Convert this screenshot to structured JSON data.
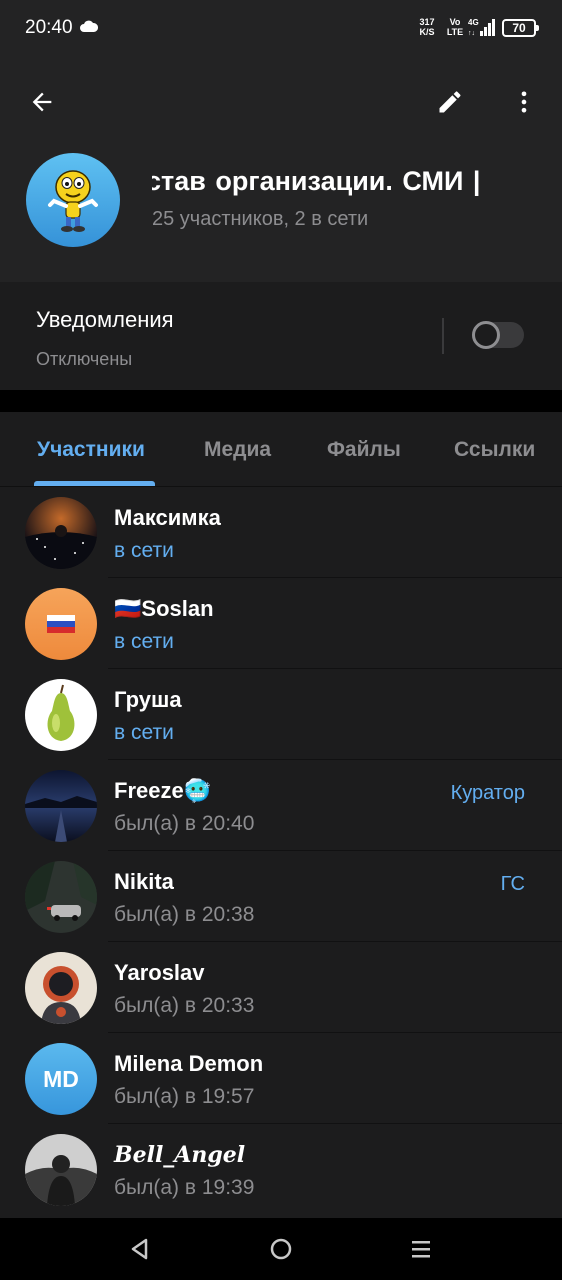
{
  "status_bar": {
    "time": "20:40",
    "net_speed_value": "317",
    "net_speed_unit": "K/S",
    "volte_top": "Vo",
    "volte_bottom": "LTE",
    "battery": "70"
  },
  "header": {
    "title": "став организации.   СМИ |",
    "subtitle": "25 участников, 2 в сети"
  },
  "notifications": {
    "label": "Уведомления",
    "value": "Отключены",
    "enabled": false
  },
  "tabs": [
    {
      "label": "Участники",
      "active": true
    },
    {
      "label": "Медиа",
      "active": false
    },
    {
      "label": "Файлы",
      "active": false
    },
    {
      "label": "Ссылки",
      "active": false
    }
  ],
  "members": [
    {
      "name": "Максимка",
      "status": "в сети",
      "online": true,
      "role": ""
    },
    {
      "name": "🇷🇺Soslan",
      "status": "в сети",
      "online": true,
      "role": ""
    },
    {
      "name": "Груша",
      "status": "в сети",
      "online": true,
      "role": ""
    },
    {
      "name": "Freeze🥶",
      "status": "был(а) в 20:40",
      "online": false,
      "role": "Куратор"
    },
    {
      "name": "Nikita",
      "status": "был(а) в 20:38",
      "online": false,
      "role": "ГС"
    },
    {
      "name": "Yaroslav",
      "status": "был(а) в 20:33",
      "online": false,
      "role": ""
    },
    {
      "name": "Milena Demon",
      "status": "был(а) в 19:57",
      "online": false,
      "role": "",
      "initials": "MD"
    },
    {
      "name": "Bell_Angel",
      "status": "был(а) в 19:39",
      "online": false,
      "role": ""
    }
  ],
  "colors": {
    "accent": "#63aef0",
    "background": "#1c1c1d",
    "header": "#232324",
    "secondary_text": "#8d8d90"
  },
  "icons": {
    "back": "arrow-left-icon",
    "edit": "pencil-icon",
    "more": "more-vertical-icon",
    "nav_back": "triangle-back-icon",
    "nav_home": "circle-home-icon",
    "nav_recents": "menu-recents-icon"
  }
}
